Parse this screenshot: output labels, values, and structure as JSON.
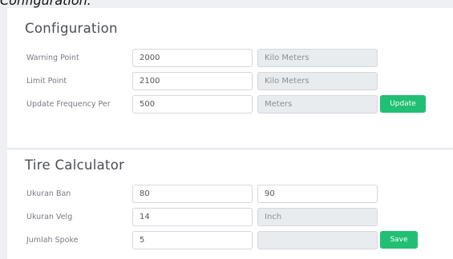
{
  "page_header": {
    "label": "Configuration:"
  },
  "configuration": {
    "title": "Configuration",
    "rows": [
      {
        "label": "Warning Point",
        "value": "2000",
        "unit": "Kilo Meters"
      },
      {
        "label": "Limit Point",
        "value": "2100",
        "unit": "Kilo Meters"
      },
      {
        "label": "Update Frequency Per",
        "value": "500",
        "unit": "Meters"
      }
    ],
    "update_button": "Update"
  },
  "tire_calculator": {
    "title": "Tire Calculator",
    "ukuran_ban": {
      "label": "Ukuran Ban",
      "value_1": "80",
      "value_2": "90"
    },
    "ukuran_velg": {
      "label": "Ukuran Velg",
      "value": "14",
      "unit": "Inch"
    },
    "jumlah_spoke": {
      "label": "Jumlah Spoke",
      "value": "5",
      "result": ""
    },
    "save_button": "Save"
  },
  "colors": {
    "page_background": "#eef0f3",
    "card_background": "#ffffff",
    "readonly_background": "#e9ecef",
    "button_green": "#21bf73"
  }
}
